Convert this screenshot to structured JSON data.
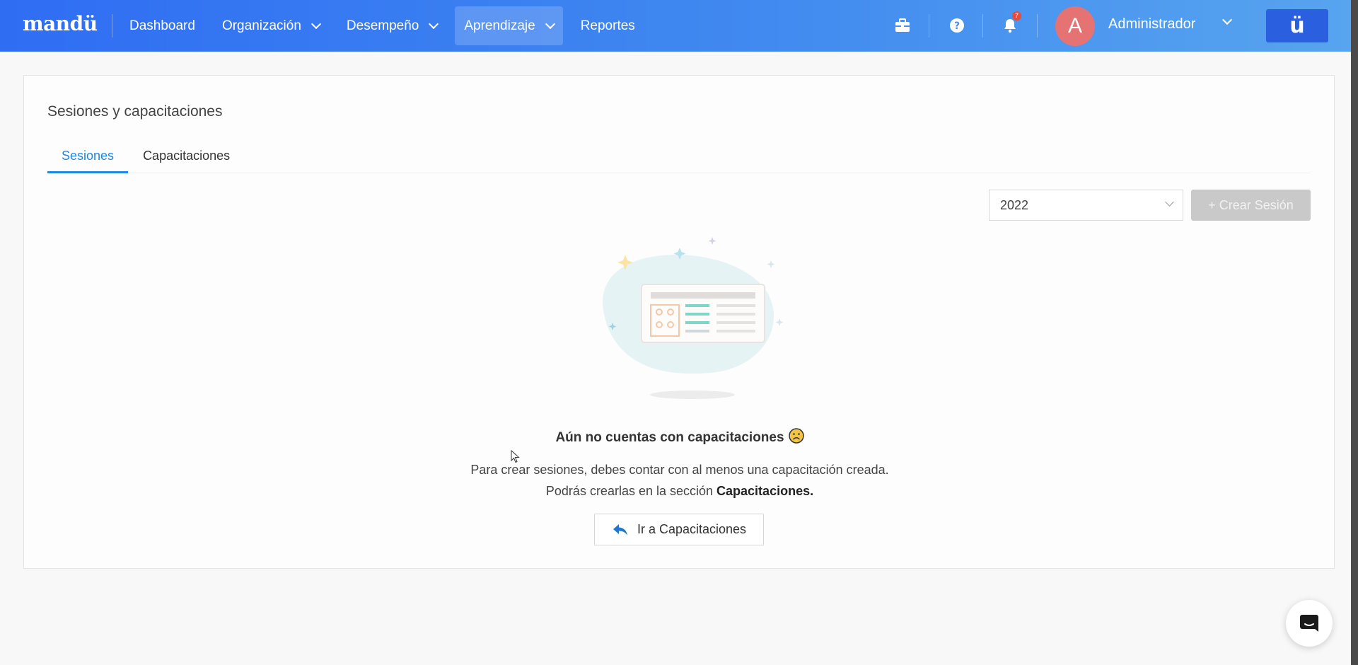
{
  "header": {
    "logo": "mandü",
    "nav": [
      {
        "label": "Dashboard",
        "has_menu": false,
        "active": false
      },
      {
        "label": "Organización",
        "has_menu": true,
        "active": false
      },
      {
        "label": "Desempeño",
        "has_menu": true,
        "active": false
      },
      {
        "label": "Aprendizaje",
        "has_menu": true,
        "active": true
      },
      {
        "label": "Reportes",
        "has_menu": false,
        "active": false
      }
    ],
    "icons": [
      "briefcase-icon",
      "help-icon",
      "bell-icon"
    ],
    "notifications_count": "7",
    "user": {
      "avatar_initial": "A",
      "name": "Administrador"
    },
    "brand_button": "ü"
  },
  "page": {
    "title": "Sesiones y capacitaciones",
    "tabs": [
      {
        "label": "Sesiones",
        "active": true
      },
      {
        "label": "Capacitaciones",
        "active": false
      }
    ],
    "year_select": {
      "value": "2022"
    },
    "create_button": "+ Crear Sesión"
  },
  "empty_state": {
    "title": "Aún no cuentas con capacitaciones",
    "line1": "Para crear sesiones, debes contar con al menos una capacitación creada.",
    "line2_prefix": "Podrás crearlas en la sección ",
    "line2_bold": "Capacitaciones.",
    "button": "Ir a Capacitaciones"
  },
  "colors": {
    "accent": "#1e88e5",
    "header_start": "#2f6df3",
    "header_end": "#57a4ef",
    "avatar": "#e57373",
    "disabled_button": "#c9c9c9"
  }
}
